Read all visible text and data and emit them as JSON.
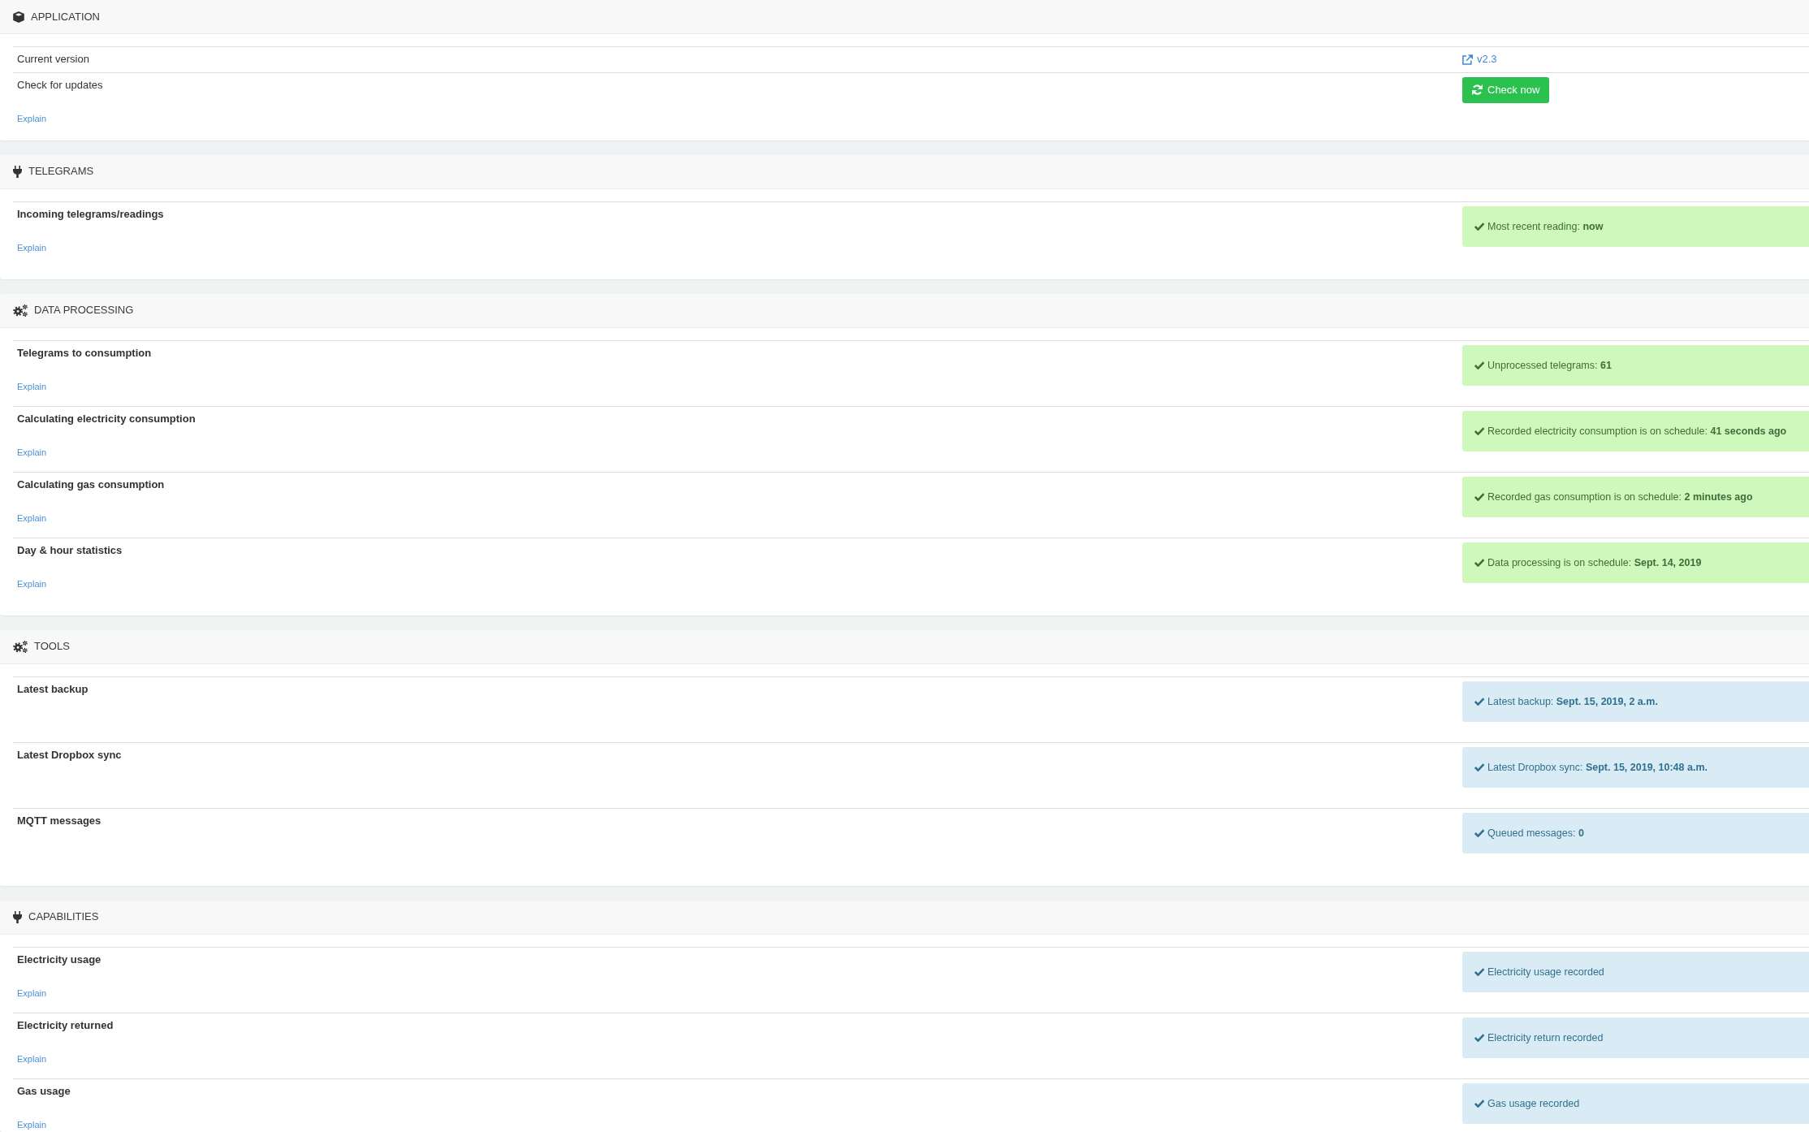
{
  "sections": [
    {
      "title": "APPLICATION",
      "rows": [
        {
          "label": "Current version",
          "value": {
            "kind": "link",
            "text": "v2.3"
          }
        },
        {
          "label": "Check for updates",
          "explain": "Explain",
          "value": {
            "kind": "button",
            "text": "Check now"
          }
        }
      ]
    },
    {
      "title": "TELEGRAMS",
      "rows": [
        {
          "label": "Incoming telegrams/readings",
          "explain": "Explain",
          "value": {
            "kind": "success",
            "text": "Most recent reading: **now**"
          }
        }
      ]
    },
    {
      "title": "DATA PROCESSING",
      "rows": [
        {
          "label": "Telegrams to consumption",
          "explain": "Explain",
          "value": {
            "kind": "success",
            "text": "Unprocessed telegrams: **61**"
          }
        },
        {
          "label": "Calculating electricity consumption",
          "explain": "Explain",
          "value": {
            "kind": "success",
            "text": "Recorded electricity consumption is on schedule: **41 seconds ago**"
          }
        },
        {
          "label": "Calculating gas consumption",
          "explain": "Explain",
          "value": {
            "kind": "success",
            "text": "Recorded gas consumption is on schedule: **2 minutes ago**"
          }
        },
        {
          "label": "Day & hour statistics",
          "explain": "Explain",
          "value": {
            "kind": "success",
            "text": "Data processing is on schedule: **Sept. 14, 2019**"
          }
        }
      ]
    },
    {
      "title": "TOOLS",
      "rows": [
        {
          "label": "Latest backup",
          "value": {
            "kind": "info",
            "text": "Latest backup: **Sept. 15, 2019, 2 a.m.**"
          }
        },
        {
          "label": "Latest Dropbox sync",
          "value": {
            "kind": "info",
            "text": "Latest Dropbox sync: **Sept. 15, 2019, 10:48 a.m.**"
          }
        },
        {
          "label": "MQTT messages",
          "value": {
            "kind": "info",
            "text": "Queued messages: **0**"
          }
        }
      ]
    },
    {
      "title": "CAPABILITIES",
      "rows": [
        {
          "label": "Electricity usage",
          "explain": "Explain",
          "value": {
            "kind": "info",
            "text": "Electricity usage recorded"
          }
        },
        {
          "label": "Electricity returned",
          "explain": "Explain",
          "value": {
            "kind": "info",
            "text": "Electricity return recorded"
          }
        },
        {
          "label": "Gas usage",
          "explain": "Explain",
          "value": {
            "kind": "info",
            "text": "Gas usage recorded"
          }
        }
      ]
    }
  ]
}
